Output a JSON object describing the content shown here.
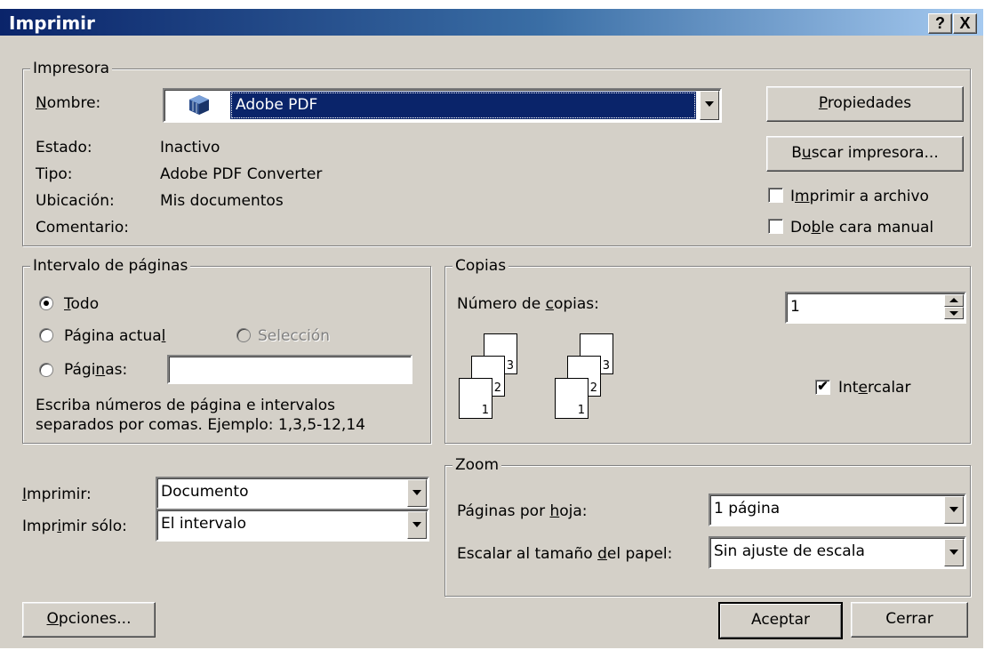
{
  "window": {
    "title": "Imprimir",
    "help_label": "?",
    "close_label": "X"
  },
  "printer": {
    "group_label": "Impresora",
    "name_label": "Nombre:",
    "name_value": "Adobe PDF",
    "status_label": "Estado:",
    "status_value": "Inactivo",
    "type_label": "Tipo:",
    "type_value": "Adobe PDF Converter",
    "location_label": "Ubicación:",
    "location_value": "Mis documentos",
    "comment_label": "Comentario:",
    "properties_button": "Propiedades",
    "find_printer_button": "Buscar impresora...",
    "print_to_file_label": "Imprimir a archivo",
    "print_to_file_checked": false,
    "manual_duplex_label": "Doble cara manual",
    "manual_duplex_checked": false
  },
  "page_range": {
    "group_label": "Intervalo de páginas",
    "all_label": "Todo",
    "current_page_label": "Página actual",
    "selection_label": "Selección",
    "pages_label": "Páginas:",
    "pages_value": "",
    "selected_option": "all",
    "help_line1": "Escriba números de página e intervalos",
    "help_line2": "separados por comas. Ejemplo: 1,3,5-12,14"
  },
  "copies": {
    "group_label": "Copias",
    "number_label": "Número de copias:",
    "number_value": "1",
    "collate_label": "Intercalar",
    "collate_checked": true,
    "collate_check_glyph": "✔",
    "page_numbers": [
      "3",
      "2",
      "1"
    ]
  },
  "print_what": {
    "print_label": "Imprimir:",
    "print_value": "Documento",
    "print_only_label": "Imprimir sólo:",
    "print_only_value": "El intervalo"
  },
  "zoom": {
    "group_label": "Zoom",
    "pages_per_sheet_label": "Páginas por hoja:",
    "pages_per_sheet_value": "1 página",
    "scale_label": "Escalar al tamaño del papel:",
    "scale_value": "Sin ajuste de escala"
  },
  "buttons": {
    "options": "Opciones...",
    "ok": "Aceptar",
    "close": "Cerrar"
  },
  "colors": {
    "titlebar_start": "#0a246a",
    "titlebar_end": "#a6caf0",
    "face": "#d4d0c8",
    "selection": "#0a246a"
  }
}
